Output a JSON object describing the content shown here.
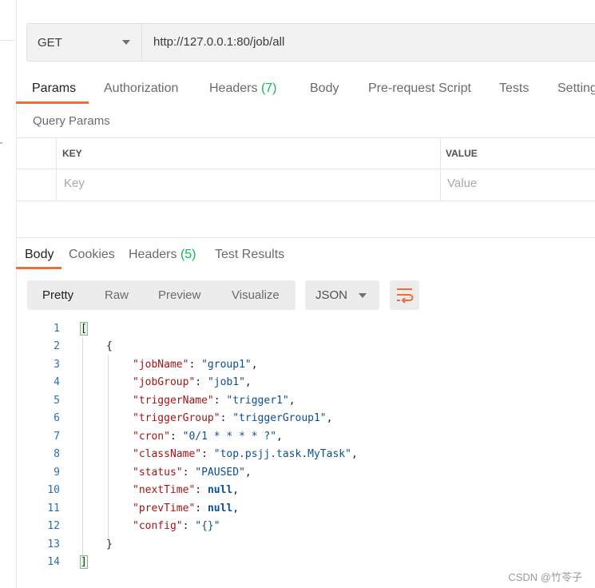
{
  "request": {
    "method": "GET",
    "url": "http://127.0.0.1:80/job/all"
  },
  "request_tabs": [
    {
      "label": "Params",
      "count": ""
    },
    {
      "label": "Authorization",
      "count": ""
    },
    {
      "label": "Headers",
      "count": "(7)"
    },
    {
      "label": "Body",
      "count": ""
    },
    {
      "label": "Pre-request Script",
      "count": ""
    },
    {
      "label": "Tests",
      "count": ""
    },
    {
      "label": "Setting",
      "count": ""
    }
  ],
  "query_params": {
    "title": "Query Params",
    "key_header": "KEY",
    "value_header": "VALUE",
    "key_placeholder": "Key",
    "value_placeholder": "Value"
  },
  "response_tabs": [
    {
      "label": "Body",
      "count": ""
    },
    {
      "label": "Cookies",
      "count": ""
    },
    {
      "label": "Headers",
      "count": "(5)"
    },
    {
      "label": "Test Results",
      "count": ""
    }
  ],
  "view_modes": [
    "Pretty",
    "Raw",
    "Preview",
    "Visualize"
  ],
  "format": "JSON",
  "icons": {
    "method_caret": "chevron-down-icon",
    "format_caret": "chevron-down-icon",
    "wrap": "wrap-lines-icon"
  },
  "colors": {
    "accent": "#f26b3a",
    "count": "#0cbb52",
    "key": "#a31515",
    "string": "#0b4f96"
  },
  "code": {
    "line_numbers": [
      "1",
      "2",
      "3",
      "4",
      "5",
      "6",
      "7",
      "8",
      "9",
      "10",
      "11",
      "12",
      "13",
      "14"
    ],
    "open_bracket": "[",
    "open_brace": "{",
    "close_brace": "}",
    "close_bracket": "]",
    "fields": [
      {
        "key": "\"jobName\"",
        "value": "\"group1\"",
        "type": "string",
        "comma": ","
      },
      {
        "key": "\"jobGroup\"",
        "value": "\"job1\"",
        "type": "string",
        "comma": ","
      },
      {
        "key": "\"triggerName\"",
        "value": "\"trigger1\"",
        "type": "string",
        "comma": ","
      },
      {
        "key": "\"triggerGroup\"",
        "value": "\"triggerGroup1\"",
        "type": "string",
        "comma": ","
      },
      {
        "key": "\"cron\"",
        "value": "\"0/1 * * * * ?\"",
        "type": "string",
        "comma": ","
      },
      {
        "key": "\"className\"",
        "value": "\"top.psjj.task.MyTask\"",
        "type": "string",
        "comma": ","
      },
      {
        "key": "\"status\"",
        "value": "\"PAUSED\"",
        "type": "string",
        "comma": ","
      },
      {
        "key": "\"nextTime\"",
        "value": "null",
        "type": "null",
        "comma": ","
      },
      {
        "key": "\"prevTime\"",
        "value": "null",
        "type": "null",
        "comma": ","
      },
      {
        "key": "\"config\"",
        "value": "\"{}\"",
        "type": "string",
        "comma": ""
      }
    ]
  },
  "watermark": "CSDN @竹苓子"
}
